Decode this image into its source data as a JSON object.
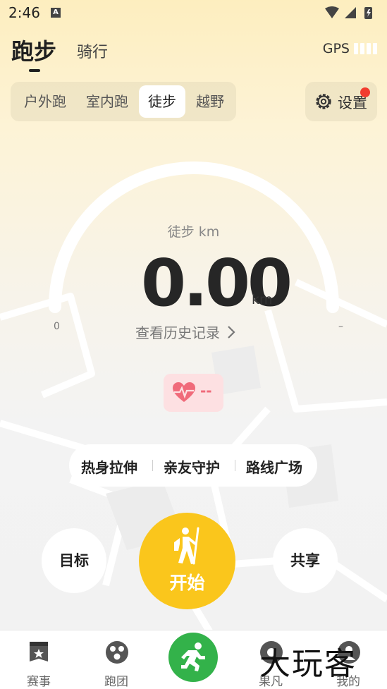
{
  "status_bar": {
    "time": "2:46",
    "notification_icon": "A"
  },
  "top_tabs": {
    "run": "跑步",
    "ride": "骑行"
  },
  "gps": {
    "label": "GPS",
    "signal_bars": 4
  },
  "mode_tabs": [
    {
      "label": "户外跑",
      "active": false
    },
    {
      "label": "室内跑",
      "active": false
    },
    {
      "label": "徒步",
      "active": true
    },
    {
      "label": "越野",
      "active": false
    }
  ],
  "settings": {
    "label": "设置",
    "has_notification_dot": true
  },
  "gauge": {
    "subtitle": "徒步  km",
    "value": "0.00",
    "unit": "km",
    "min_label": "0",
    "max_label": "–",
    "history_link": "查看历史记录"
  },
  "heart_rate": {
    "value": "--",
    "icon": "heart-pulse-icon"
  },
  "quick_actions": [
    "热身拉伸",
    "亲友守护",
    "路线广场"
  ],
  "buttons": {
    "goal": "目标",
    "start": "开始",
    "share": "共享"
  },
  "bottom_nav": [
    {
      "label": "赛事",
      "icon": "event-badge-icon"
    },
    {
      "label": "跑团",
      "icon": "group-icon"
    },
    {
      "label": "",
      "icon": "runner-icon"
    },
    {
      "label": "果凡",
      "icon": "discover-icon"
    },
    {
      "label": "我的",
      "icon": "profile-icon"
    }
  ],
  "watermark": "大玩客",
  "colors": {
    "accent_yellow": "#fac61c",
    "nav_green": "#33b24a",
    "heart_pink": "#f06a7a",
    "dot_red": "#f23b2e"
  }
}
